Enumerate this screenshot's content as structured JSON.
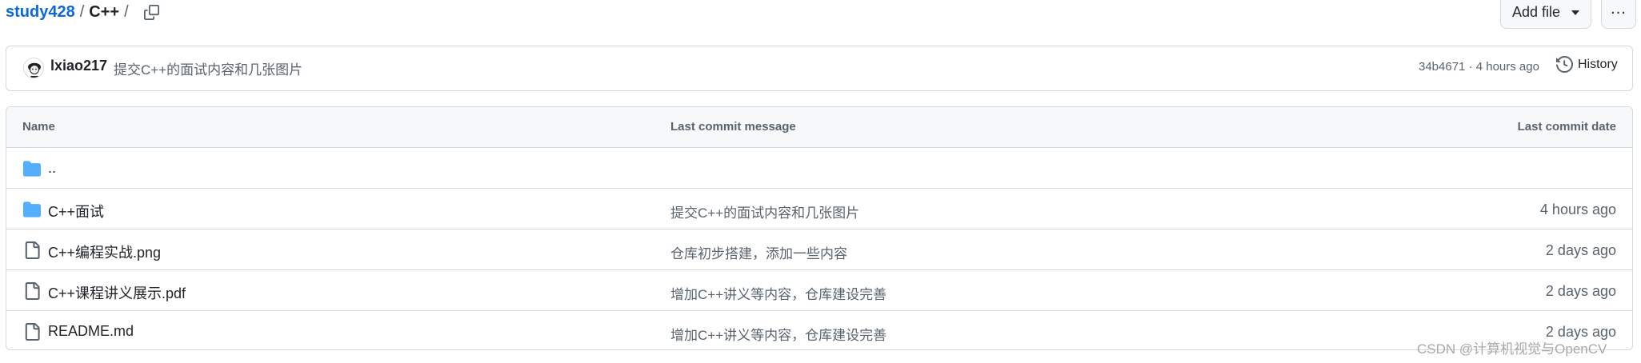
{
  "breadcrumb": {
    "repo": "study428",
    "separator": "/",
    "current": "C++",
    "trailing": "/"
  },
  "actions": {
    "add_file_label": "Add file",
    "more_label": "..."
  },
  "latest_commit": {
    "author": "lxiao217",
    "message": "提交C++的面试内容和几张图片",
    "meta": "34b4671 · 4 hours ago",
    "history_label": "History"
  },
  "table": {
    "headers": {
      "name": "Name",
      "message": "Last commit message",
      "date": "Last commit date"
    },
    "rows": [
      {
        "type": "parent-dir",
        "name": "..",
        "message": "",
        "date": ""
      },
      {
        "type": "folder",
        "name": "C++面试",
        "message": "提交C++的面试内容和几张图片",
        "date": "4 hours ago"
      },
      {
        "type": "file",
        "name": "C++编程实战.png",
        "message": "仓库初步搭建，添加一些内容",
        "date": "2 days ago"
      },
      {
        "type": "file",
        "name": "C++课程讲义展示.pdf",
        "message": "增加C++讲义等内容，仓库建设完善",
        "date": "2 days ago"
      },
      {
        "type": "file",
        "name": "README.md",
        "message": "增加C++讲义等内容，仓库建设完善",
        "date": "2 days ago"
      }
    ]
  },
  "watermark": "CSDN @计算机视觉与OpenCV",
  "colors": {
    "link": "#0969da",
    "folder": "#54aeff",
    "muted": "#59636e",
    "border": "#d1d9e0",
    "header_bg": "#f6f8fa"
  }
}
